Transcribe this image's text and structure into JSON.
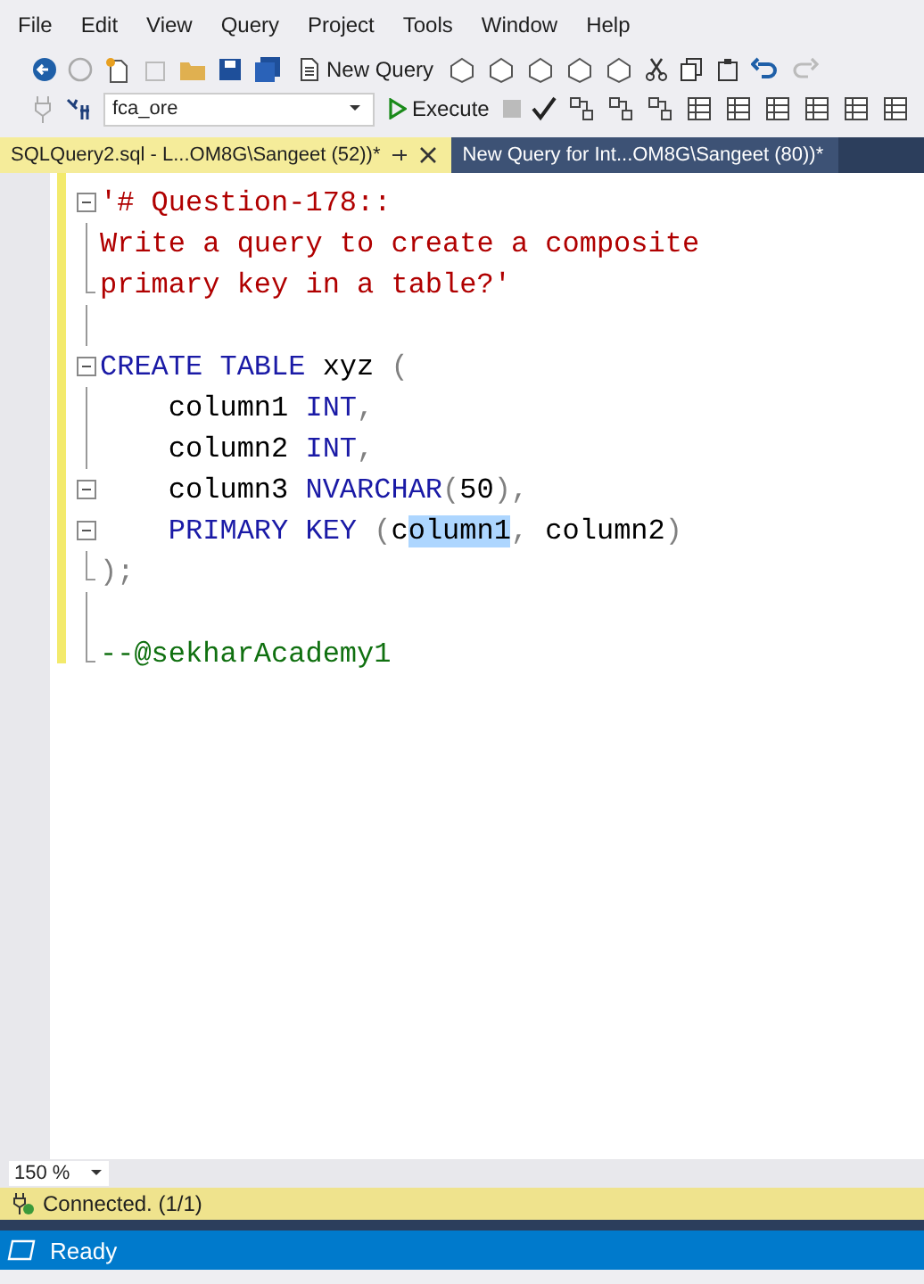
{
  "menu": [
    "File",
    "Edit",
    "View",
    "Query",
    "Project",
    "Tools",
    "Window",
    "Help"
  ],
  "toolbar": {
    "new_query": "New Query",
    "database": "fca_ore",
    "execute": "Execute"
  },
  "tabs": [
    {
      "label": "SQLQuery2.sql - L...OM8G\\Sangeet (52))*",
      "selected": true
    },
    {
      "label": "New Query for Int...OM8G\\Sangeet (80))*",
      "selected": false
    }
  ],
  "editor": {
    "lines": [
      {
        "kind": "fold-start",
        "tokens": [
          {
            "kind": "string",
            "text": "'# Question-178::"
          }
        ]
      },
      {
        "kind": "fold-body",
        "tokens": [
          {
            "kind": "string",
            "text": "Write a query to create a composite"
          }
        ]
      },
      {
        "kind": "fold-end",
        "tokens": [
          {
            "kind": "string",
            "text": "primary key in a table?'"
          }
        ]
      },
      {
        "kind": "fold-body"
      },
      {
        "kind": "fold-start",
        "tokens": [
          {
            "kind": "keyword",
            "text": "CREATE TABLE"
          },
          {
            "kind": "plain",
            "text": " xyz "
          },
          {
            "kind": "gray",
            "text": "("
          }
        ]
      },
      {
        "kind": "fold-body",
        "tokens": [
          {
            "kind": "plain",
            "text": "    column1 "
          },
          {
            "kind": "keyword",
            "text": "INT"
          },
          {
            "kind": "gray",
            "text": ","
          }
        ]
      },
      {
        "kind": "fold-body",
        "tokens": [
          {
            "kind": "plain",
            "text": "    column2 "
          },
          {
            "kind": "keyword",
            "text": "INT"
          },
          {
            "kind": "gray",
            "text": ","
          }
        ]
      },
      {
        "kind": "fold-start",
        "tokens": [
          {
            "kind": "plain",
            "text": "    column3 "
          },
          {
            "kind": "keyword",
            "text": "NVARCHAR"
          },
          {
            "kind": "gray",
            "text": "("
          },
          {
            "kind": "plain",
            "text": "50"
          },
          {
            "kind": "gray",
            "text": "),"
          }
        ]
      },
      {
        "kind": "fold-start",
        "tokens": [
          {
            "kind": "keyword",
            "text": "    PRIMARY KEY "
          },
          {
            "kind": "gray",
            "text": "("
          },
          {
            "kind": "plain",
            "text": "c"
          },
          {
            "kind": "highlight",
            "text": "olumn1"
          },
          {
            "kind": "gray",
            "text": ", "
          },
          {
            "kind": "plain",
            "text": "column2"
          },
          {
            "kind": "gray",
            "text": ")"
          }
        ]
      },
      {
        "kind": "fold-end",
        "tokens": [
          {
            "kind": "gray",
            "text": ");"
          }
        ]
      },
      {
        "kind": "fold-body"
      },
      {
        "kind": "fold-end",
        "tokens": [
          {
            "kind": "comment",
            "text": "--@sekharAcademy1"
          }
        ]
      }
    ]
  },
  "zoom": "150 %",
  "connection": "Connected. (1/1)",
  "status": "Ready"
}
